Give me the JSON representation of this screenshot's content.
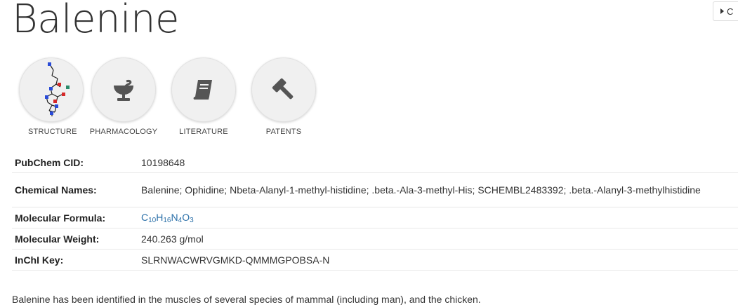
{
  "compound": {
    "name": "Balenine"
  },
  "corner_button": {
    "label": "C"
  },
  "categories": [
    {
      "label": "STRUCTURE",
      "icon": "molecule-structure-icon"
    },
    {
      "label": "PHARMACOLOGY",
      "icon": "pharmacy-bowl-icon"
    },
    {
      "label": "LITERATURE",
      "icon": "book-icon"
    },
    {
      "label": "PATENTS",
      "icon": "gavel-icon"
    }
  ],
  "properties": {
    "cid": {
      "key": "PubChem CID:",
      "value": "10198648"
    },
    "names": {
      "key": "Chemical Names:",
      "value": "Balenine; Ophidine; Nbeta-Alanyl-1-methyl-histidine; .beta.-Ala-3-methyl-His; SCHEMBL2483392; .beta.-Alanyl-3-methylhistidine"
    },
    "formula": {
      "key": "Molecular Formula:",
      "parts": [
        {
          "el": "C",
          "n": "10"
        },
        {
          "el": "H",
          "n": "16"
        },
        {
          "el": "N",
          "n": "4"
        },
        {
          "el": "O",
          "n": "3"
        }
      ]
    },
    "weight": {
      "key": "Molecular Weight:",
      "value": "240.263 g/mol"
    },
    "inchi": {
      "key": "InChI Key:",
      "value": "SLRNWACWRVGMKD-QMMMGPOBSA-N"
    }
  },
  "description": "Balenine has been identified in the muscles of several species of mammal (including man), and the chicken.",
  "colors": {
    "formula_link": "#2a6fa8",
    "icon_gray": "#555555",
    "circle_bg": "#f0f0f0"
  }
}
